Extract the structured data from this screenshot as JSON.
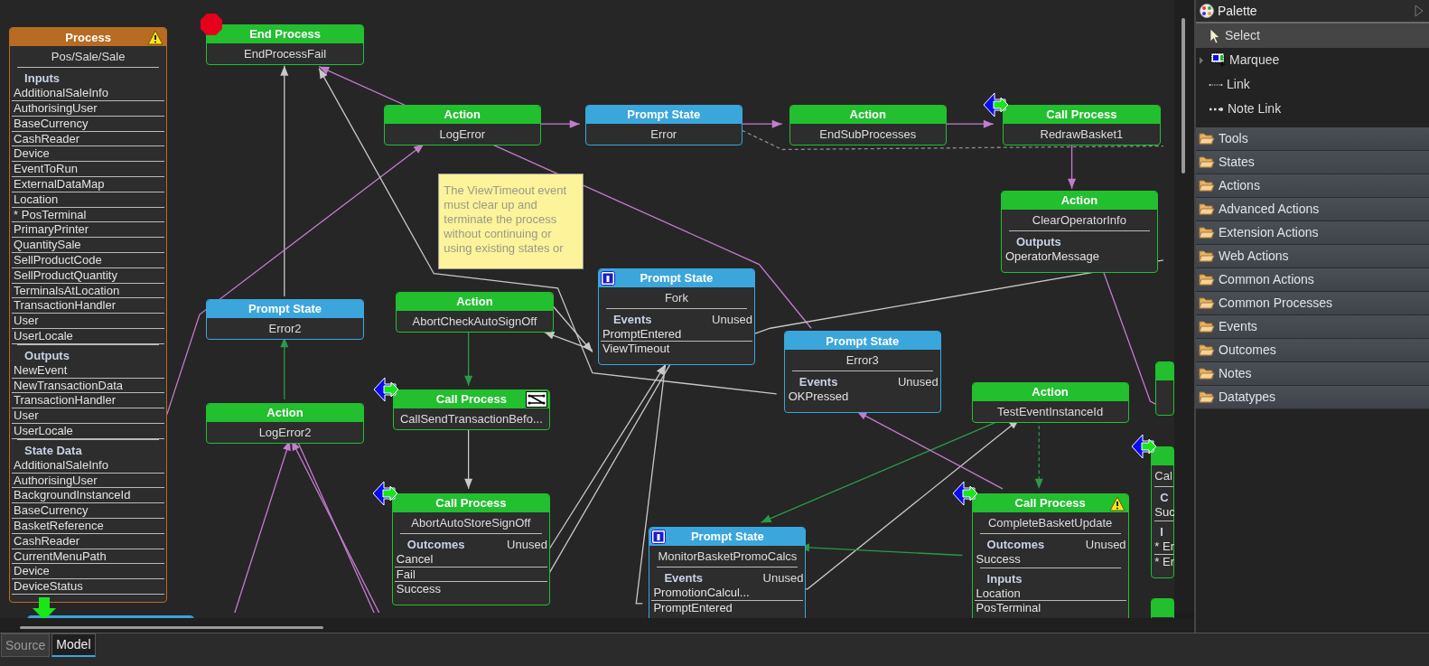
{
  "canvas": {
    "nodes": [
      {
        "kind": "process",
        "header": "Process",
        "warning": true,
        "name": "Pos/Sale/Sale",
        "sections": [
          {
            "title": "Inputs",
            "items": [
              "AdditionalSaleInfo",
              "AuthorisingUser",
              "BaseCurrency",
              "CashReader",
              "Device",
              "EventToRun",
              "ExternalDataMap",
              "Location",
              "* PosTerminal",
              "PrimaryPrinter",
              "QuantitySale",
              "SellProductCode",
              "SellProductQuantity",
              "TerminalsAtLocation",
              "TransactionHandler",
              "User",
              "UserLocale"
            ]
          },
          {
            "title": "Outputs",
            "items": [
              "NewEvent",
              "NewTransactionData",
              "TransactionHandler",
              "User",
              "UserLocale"
            ]
          },
          {
            "title": "State Data",
            "items": [
              "AdditionalSaleInfo",
              "AuthorisingUser",
              "BackgroundInstanceId",
              "BaseCurrency",
              "BasketReference",
              "CashReader",
              "CurrentMenuPath",
              "Device",
              "DeviceStatus"
            ]
          }
        ]
      },
      {
        "kind": "end",
        "header": "End Process",
        "stop_marker": true,
        "name": "EndProcessFail"
      },
      {
        "kind": "action",
        "header": "Action",
        "name": "LogError"
      },
      {
        "kind": "prompt",
        "header": "Prompt State",
        "name": "Error"
      },
      {
        "kind": "action",
        "header": "Action",
        "name": "EndSubProcesses"
      },
      {
        "kind": "call",
        "header": "Call Process",
        "call_marker": true,
        "name": "RedrawBasket1"
      },
      {
        "kind": "action",
        "header": "Action",
        "name": "ClearOperatorInfo",
        "sections": [
          {
            "title": "Outputs",
            "items": [
              "OperatorMessage"
            ]
          }
        ]
      },
      {
        "kind": "prompt",
        "header": "Prompt State",
        "name": "Error2"
      },
      {
        "kind": "action",
        "header": "Action",
        "name": "AbortCheckAutoSignOff"
      },
      {
        "kind": "prompt",
        "header": "Prompt State",
        "info_badge": true,
        "name": "Fork",
        "sections": [
          {
            "title": "Events",
            "status": "Unused",
            "items": [
              "PromptEntered",
              "ViewTimeout"
            ]
          }
        ]
      },
      {
        "kind": "prompt",
        "header": "Prompt State",
        "name": "Error3",
        "sections": [
          {
            "title": "Events",
            "status": "Unused",
            "items": [
              "OKPressed"
            ]
          }
        ]
      },
      {
        "kind": "action",
        "header": "Action",
        "name": "LogError2"
      },
      {
        "kind": "call",
        "header": "Call Process",
        "call_marker": true,
        "map_badge": true,
        "name": "CallSendTransactionBefo..."
      },
      {
        "kind": "action",
        "header": "Action",
        "name": "TestEventInstanceId"
      },
      {
        "kind": "call",
        "header": "Call Process",
        "call_marker": true,
        "name": "AbortAutoStoreSignOff",
        "sections": [
          {
            "title": "Outcomes",
            "status": "Unused",
            "items": [
              "Cancel",
              "Fail",
              "Success"
            ]
          }
        ]
      },
      {
        "kind": "prompt",
        "header": "Prompt State",
        "info_badge": true,
        "name": "MonitorBasketPromoCalcs",
        "sections": [
          {
            "title": "Events",
            "status": "Unused",
            "items": [
              "PromotionCalcul...",
              "PromptEntered"
            ]
          }
        ]
      },
      {
        "kind": "call",
        "header": "Call Process",
        "call_marker": true,
        "warning": true,
        "name": "CompleteBasketUpdate",
        "sections": [
          {
            "title": "Outcomes",
            "status": "Unused",
            "items": [
              "Success"
            ]
          },
          {
            "title": "Inputs",
            "items": [
              "Location",
              "PosTerminal"
            ]
          }
        ]
      },
      {
        "kind": "call",
        "call_marker": true,
        "name": "Cal",
        "sections": [
          {
            "title": "C",
            "items": [
              "Suc"
            ]
          },
          {
            "title": "I",
            "items": [
              "* Er",
              "* Er"
            ]
          }
        ]
      },
      {
        "kind": "action"
      },
      {
        "kind": "action"
      },
      {
        "kind": "prompt",
        "entry_marker": true
      }
    ],
    "note": {
      "text": "The ViewTimeout event must clear up and terminate the process without continuing or using existing states or"
    }
  },
  "palette": {
    "title": "Palette",
    "tools": [
      {
        "kind": "pointer",
        "label": "Select",
        "selected": true,
        "expandable": false
      },
      {
        "kind": "marquee",
        "label": "Marquee",
        "selected": false,
        "expandable": true
      },
      {
        "kind": "link",
        "label": "Link",
        "selected": false,
        "expandable": false
      },
      {
        "kind": "note-link",
        "label": "Note Link",
        "selected": false,
        "expandable": false
      }
    ],
    "drawers": [
      {
        "label": "Tools"
      },
      {
        "label": "States"
      },
      {
        "label": "Actions"
      },
      {
        "label": "Advanced Actions"
      },
      {
        "label": "Extension Actions"
      },
      {
        "label": "Web Actions"
      },
      {
        "label": "Common Actions"
      },
      {
        "label": "Common Processes"
      },
      {
        "label": "Events"
      },
      {
        "label": "Outcomes"
      },
      {
        "label": "Notes"
      },
      {
        "label": "Datatypes"
      }
    ]
  },
  "tabs": [
    {
      "label": "Source",
      "selected": false
    },
    {
      "label": "Model",
      "selected": true
    }
  ]
}
